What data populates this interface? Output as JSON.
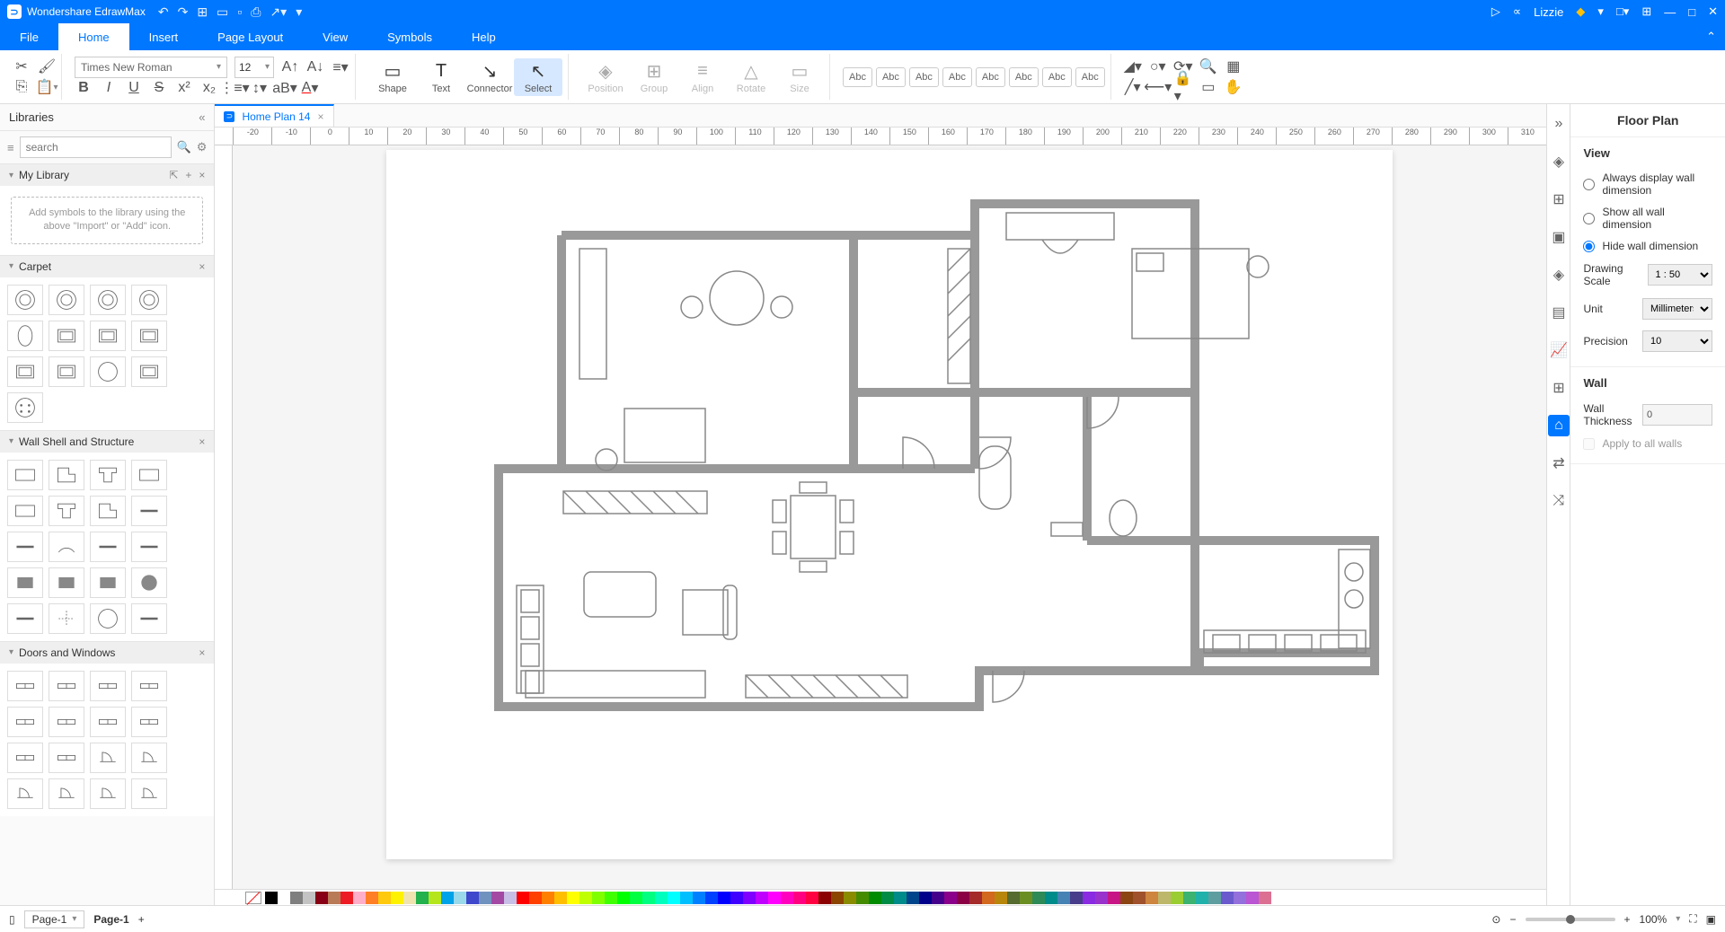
{
  "app": {
    "name": "Wondershare EdrawMax"
  },
  "titlebar": {
    "user": "Lizzie",
    "icons": [
      "↶",
      "↷",
      "⊞",
      "▭",
      "▭",
      "⎙",
      "↗",
      "▾"
    ]
  },
  "menu": {
    "tabs": [
      "File",
      "Home",
      "Insert",
      "Page Layout",
      "View",
      "Symbols",
      "Help"
    ],
    "active": "Home"
  },
  "ribbon": {
    "font": "Times New Roman",
    "size": "12",
    "tools": [
      {
        "label": "Shape",
        "icon": "▭"
      },
      {
        "label": "Text",
        "icon": "T"
      },
      {
        "label": "Connector",
        "icon": "↘"
      },
      {
        "label": "Select",
        "icon": "↖",
        "active": true
      }
    ],
    "disabledTools": [
      {
        "label": "Position",
        "icon": "◈"
      },
      {
        "label": "Group",
        "icon": "⊞"
      },
      {
        "label": "Align",
        "icon": "≡"
      },
      {
        "label": "Rotate",
        "icon": "△"
      },
      {
        "label": "Size",
        "icon": "▭"
      }
    ],
    "abc": [
      "Abc",
      "Abc",
      "Abc",
      "Abc",
      "Abc",
      "Abc",
      "Abc",
      "Abc"
    ]
  },
  "library": {
    "title": "Libraries",
    "searchPlaceholder": "search",
    "mylib": {
      "title": "My Library",
      "placeholder": "Add symbols to the library using the above \"Import\" or \"Add\" icon."
    },
    "sections": [
      "Carpet",
      "Wall Shell and Structure",
      "Doors and Windows"
    ]
  },
  "document": {
    "tab": "Home Plan 14"
  },
  "ruler": [
    "-20",
    "-10",
    "0",
    "10",
    "20",
    "30",
    "40",
    "50",
    "60",
    "70",
    "80",
    "90",
    "100",
    "110",
    "120",
    "130",
    "140",
    "150",
    "160",
    "170",
    "180",
    "190",
    "200",
    "210",
    "220",
    "230",
    "240",
    "250",
    "260",
    "270",
    "280",
    "290",
    "300",
    "310"
  ],
  "rightPanel": {
    "title": "Floor Plan",
    "viewLabel": "View",
    "viewOptions": [
      {
        "label": "Always display wall dimension",
        "checked": false
      },
      {
        "label": "Show all wall dimension",
        "checked": false
      },
      {
        "label": "Hide wall dimension",
        "checked": true
      }
    ],
    "scaleLabel": "Drawing Scale",
    "scaleValue": "1 : 50",
    "unitLabel": "Unit",
    "unitValue": "Millimeters",
    "precisionLabel": "Precision",
    "precisionValue": "10",
    "wallLabel": "Wall",
    "thicknessLabel": "Wall Thickness",
    "thicknessValue": "0",
    "applyLabel": "Apply to all walls"
  },
  "status": {
    "page": "Page-1",
    "pageLabel": "Page-1",
    "zoom": "100%"
  },
  "colors": [
    "#000",
    "#fff",
    "#7f7f7f",
    "#c3c3c3",
    "#880015",
    "#b97a57",
    "#ed1c24",
    "#ffaec9",
    "#ff7f27",
    "#ffc90e",
    "#fff200",
    "#efe4b0",
    "#22b14c",
    "#b5e61d",
    "#00a2e8",
    "#99d9ea",
    "#3f48cc",
    "#7092be",
    "#a349a4",
    "#c8bfe7",
    "#ff0000",
    "#ff4000",
    "#ff8000",
    "#ffbf00",
    "#ffff00",
    "#bfff00",
    "#80ff00",
    "#40ff00",
    "#00ff00",
    "#00ff40",
    "#00ff80",
    "#00ffbf",
    "#00ffff",
    "#00bfff",
    "#0080ff",
    "#0040ff",
    "#0000ff",
    "#4000ff",
    "#8000ff",
    "#bf00ff",
    "#ff00ff",
    "#ff00bf",
    "#ff0080",
    "#ff0040",
    "#8b0000",
    "#8b4500",
    "#8b8b00",
    "#458b00",
    "#008b00",
    "#008b45",
    "#008b8b",
    "#00458b",
    "#00008b",
    "#45008b",
    "#8b008b",
    "#8b0045",
    "#a52a2a",
    "#d2691e",
    "#b8860b",
    "#556b2f",
    "#6b8e23",
    "#2e8b57",
    "#008b8b",
    "#4682b4",
    "#483d8b",
    "#8a2be2",
    "#9932cc",
    "#c71585",
    "#8b4513",
    "#a0522d",
    "#cd853f",
    "#bdb76b",
    "#9acd32",
    "#3cb371",
    "#20b2aa",
    "#5f9ea0",
    "#6a5acd",
    "#9370db",
    "#ba55d3",
    "#db7093"
  ]
}
